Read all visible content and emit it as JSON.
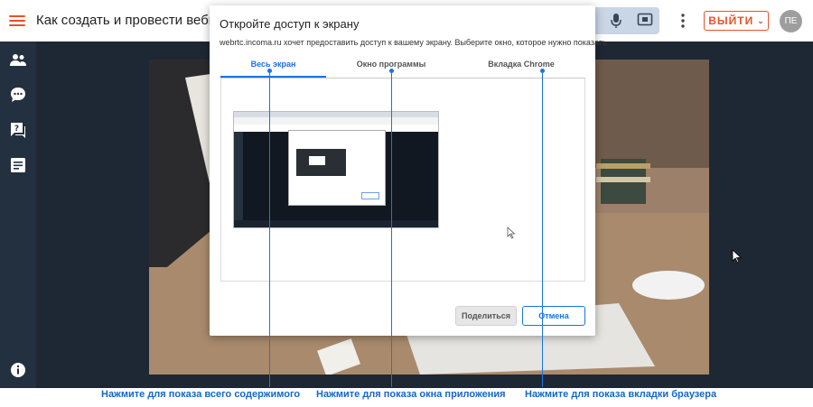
{
  "header": {
    "title": "Как создать и провести вебинар?",
    "exit_label": "ВЫЙТИ",
    "avatar_initials": "ПЕ",
    "accent_color": "#e8522a"
  },
  "sidebar": {
    "items": [
      {
        "icon": "participants-icon"
      },
      {
        "icon": "chat-icon"
      },
      {
        "icon": "questions-icon"
      },
      {
        "icon": "notes-icon"
      },
      {
        "icon": "info-icon"
      }
    ]
  },
  "dialog": {
    "title": "Откройте доступ к экрану",
    "description": "webrtc.incoma.ru хочет предоставить доступ к вашему экрану. Выберите окно, которое нужно показать.",
    "tabs": [
      {
        "label": "Весь экран",
        "active": true
      },
      {
        "label": "Окно программы",
        "active": false
      },
      {
        "label": "Вкладка Chrome",
        "active": false
      }
    ],
    "share_label": "Поделиться",
    "cancel_label": "Отмена"
  },
  "annotations": {
    "color": "#1a73e8",
    "captions": [
      "Нажмите для показа всего содержимого",
      "Нажмите для показа окна приложения",
      "Нажмите для показа вкладки браузера"
    ]
  }
}
